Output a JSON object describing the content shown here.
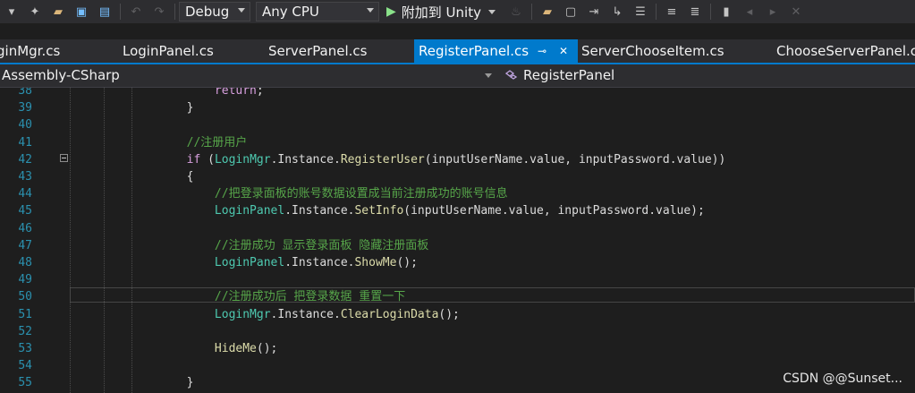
{
  "toolbar": {
    "configuration": "Debug",
    "platform": "Any CPU",
    "run_label": "附加到 Unity",
    "icons": [
      "new-item-icon",
      "open-folder-icon",
      "save-icon",
      "save-all-icon",
      "undo-icon",
      "redo-icon",
      "play-icon",
      "hot-reload-icon",
      "folder-browse-icon",
      "window-icon",
      "step-icon",
      "step-out-icon",
      "comment-icon",
      "uncomment-icon",
      "bookmark-icon",
      "prev-bookmark-icon",
      "next-bookmark-icon",
      "clear-bookmark-icon"
    ]
  },
  "tabs": [
    {
      "label": "ginMgr.cs",
      "active": false
    },
    {
      "label": "LoginPanel.cs",
      "active": false
    },
    {
      "label": "ServerPanel.cs",
      "active": false
    },
    {
      "label": "RegisterPanel.cs",
      "active": true
    },
    {
      "label": "ServerChooseItem.cs",
      "active": false
    },
    {
      "label": "ChooseServerPanel.cs",
      "active": false
    }
  ],
  "navbar": {
    "project": "Assembly-CSharp",
    "class": "RegisterPanel"
  },
  "editor": {
    "line_numbers": [
      "38",
      "39",
      "40",
      "41",
      "42",
      "43",
      "44",
      "45",
      "46",
      "47",
      "48",
      "49",
      "50",
      "51",
      "52",
      "53",
      "54",
      "55"
    ],
    "lines": [
      {
        "indent": "            ",
        "tokens": [
          {
            "t": "ctl",
            "v": "return"
          },
          {
            "t": "plain",
            "v": ";"
          }
        ]
      },
      {
        "indent": "        ",
        "tokens": [
          {
            "t": "plain",
            "v": "}"
          }
        ]
      },
      {
        "indent": "",
        "tokens": []
      },
      {
        "indent": "        ",
        "tokens": [
          {
            "t": "cm",
            "v": "//注册用户"
          }
        ]
      },
      {
        "indent": "        ",
        "tokens": [
          {
            "t": "ctl",
            "v": "if"
          },
          {
            "t": "plain",
            "v": " ("
          },
          {
            "t": "type",
            "v": "LoginMgr"
          },
          {
            "t": "plain",
            "v": ".Instance."
          },
          {
            "t": "fn",
            "v": "RegisterUser"
          },
          {
            "t": "plain",
            "v": "(inputUserName.value, inputPassword.value))"
          }
        ]
      },
      {
        "indent": "        ",
        "tokens": [
          {
            "t": "plain",
            "v": "{"
          }
        ]
      },
      {
        "indent": "            ",
        "tokens": [
          {
            "t": "cm",
            "v": "//把登录面板的账号数据设置成当前注册成功的账号信息"
          }
        ]
      },
      {
        "indent": "            ",
        "tokens": [
          {
            "t": "type",
            "v": "LoginPanel"
          },
          {
            "t": "plain",
            "v": ".Instance."
          },
          {
            "t": "fn",
            "v": "SetInfo"
          },
          {
            "t": "plain",
            "v": "(inputUserName.value, inputPassword.value);"
          }
        ]
      },
      {
        "indent": "",
        "tokens": []
      },
      {
        "indent": "            ",
        "tokens": [
          {
            "t": "cm",
            "v": "//注册成功 显示登录面板 隐藏注册面板"
          }
        ]
      },
      {
        "indent": "            ",
        "tokens": [
          {
            "t": "type",
            "v": "LoginPanel"
          },
          {
            "t": "plain",
            "v": ".Instance."
          },
          {
            "t": "fn",
            "v": "ShowMe"
          },
          {
            "t": "plain",
            "v": "();"
          }
        ]
      },
      {
        "indent": "",
        "tokens": []
      },
      {
        "indent": "            ",
        "tokens": [
          {
            "t": "cm",
            "v": "//注册成功后 把登录数据 重置一下"
          }
        ]
      },
      {
        "indent": "            ",
        "tokens": [
          {
            "t": "type",
            "v": "LoginMgr"
          },
          {
            "t": "plain",
            "v": ".Instance."
          },
          {
            "t": "fn",
            "v": "ClearLoginData"
          },
          {
            "t": "plain",
            "v": "();"
          }
        ]
      },
      {
        "indent": "",
        "tokens": []
      },
      {
        "indent": "            ",
        "tokens": [
          {
            "t": "fn",
            "v": "HideMe"
          },
          {
            "t": "plain",
            "v": "();"
          }
        ]
      },
      {
        "indent": "",
        "tokens": []
      },
      {
        "indent": "        ",
        "tokens": [
          {
            "t": "plain",
            "v": "}"
          }
        ]
      }
    ]
  },
  "watermark": "CSDN @@Sunset..."
}
